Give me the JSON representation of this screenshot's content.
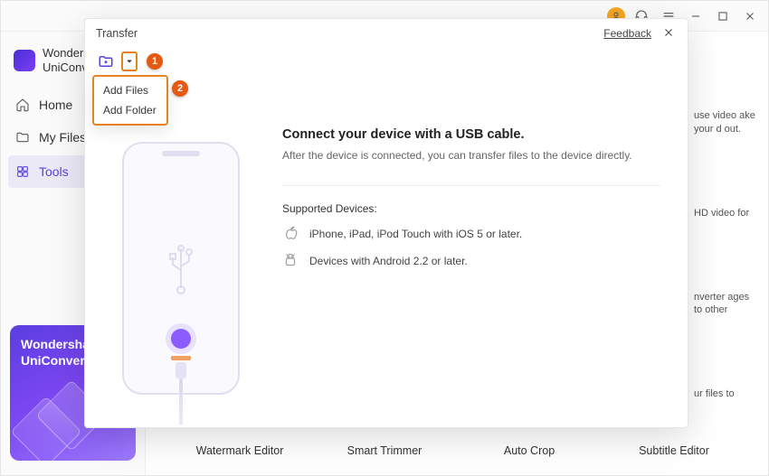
{
  "titlebar": {},
  "brand": {
    "name": "Wondershare\nUniConverter"
  },
  "nav": {
    "home": "Home",
    "myfiles": "My Files",
    "tools": "Tools"
  },
  "promo": {
    "title": "Wondershare\nUniConverter"
  },
  "side_hints": {
    "h1": "use video ake your d out.",
    "h2": "HD video for",
    "h3": "nverter ages to other",
    "h4": "ur files to"
  },
  "bottom_tools": {
    "a": "Watermark Editor",
    "b": "Smart Trimmer",
    "c": "Auto Crop",
    "d": "Subtitle Editor"
  },
  "modal": {
    "title": "Transfer",
    "feedback": "Feedback",
    "badges": {
      "one": "1",
      "two": "2"
    },
    "dropdown": {
      "add_files": "Add Files",
      "add_folder": "Add Folder"
    },
    "info": {
      "title": "Connect your device with a USB cable.",
      "sub": "After the device is connected, you can transfer files to the device directly.",
      "supported_title": "Supported Devices:",
      "ios": "iPhone, iPad, iPod Touch with iOS 5 or later.",
      "android": "Devices with Android 2.2 or later."
    }
  }
}
